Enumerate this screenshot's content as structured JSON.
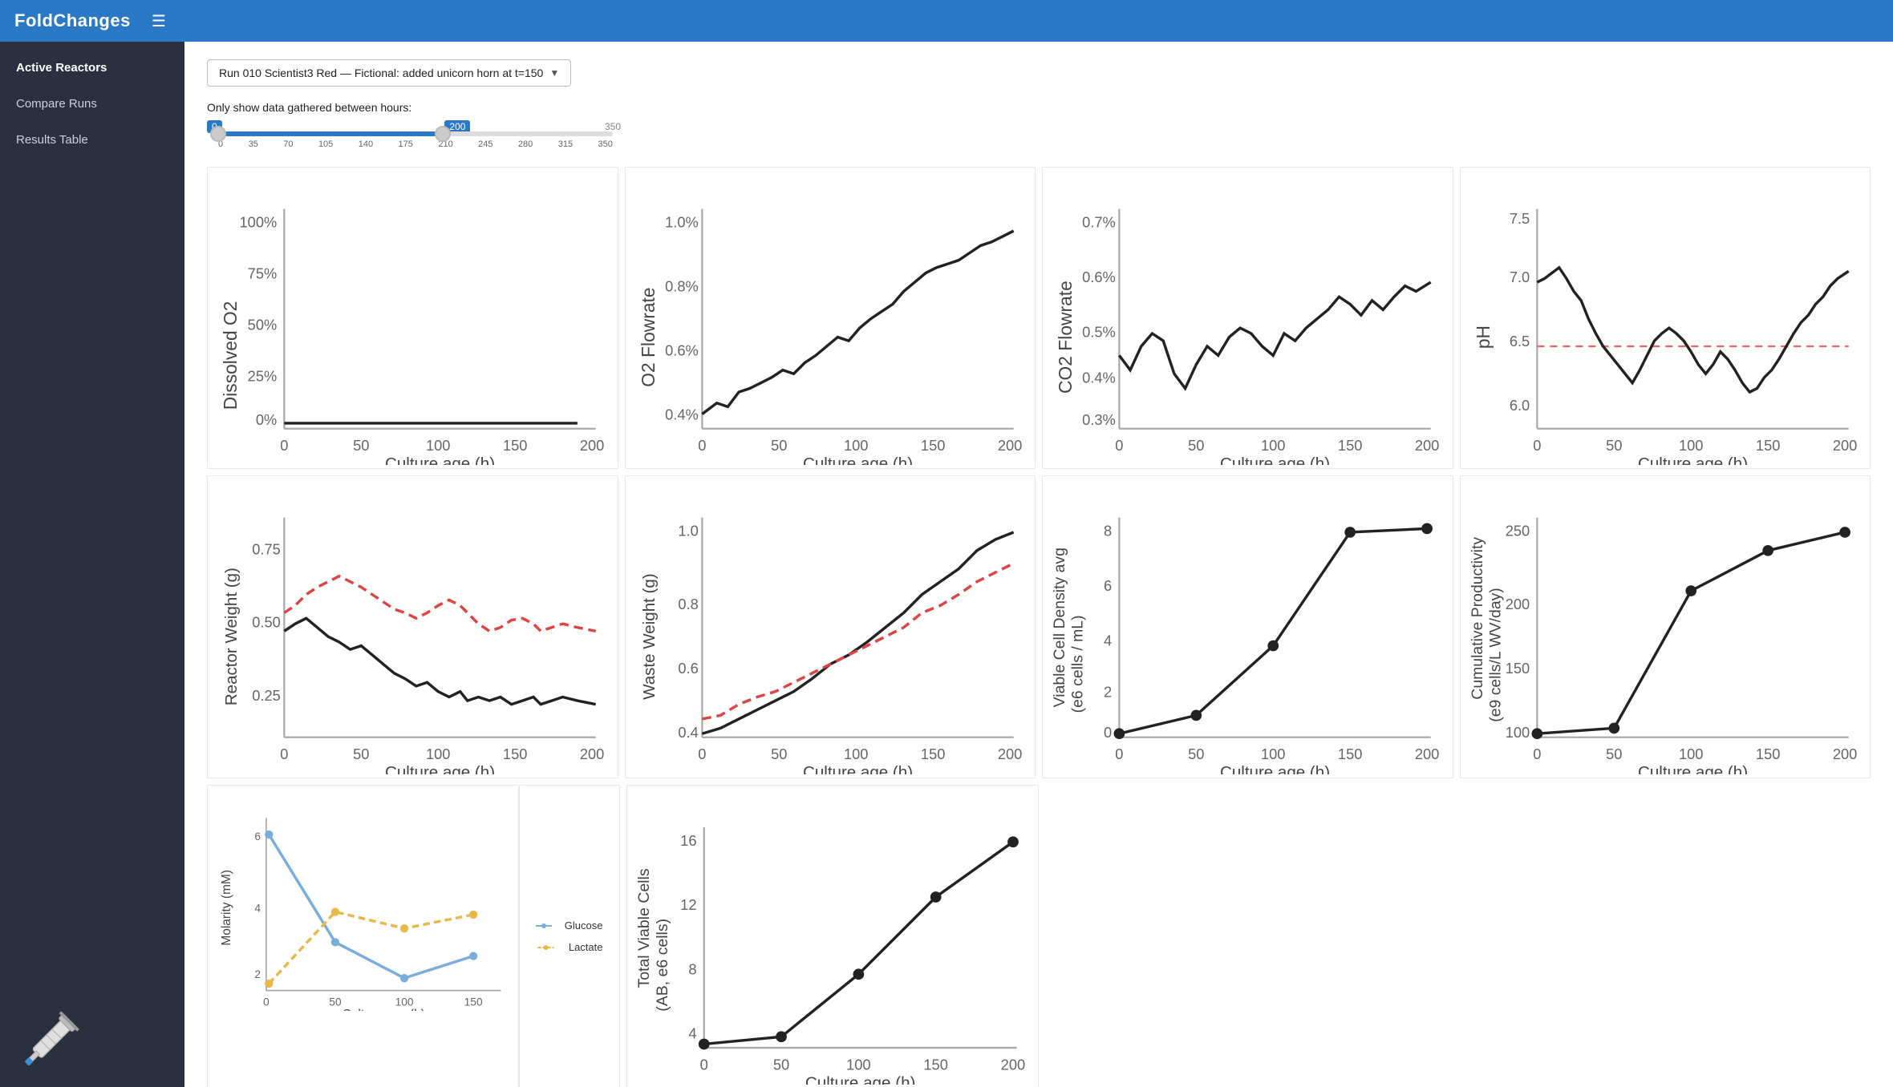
{
  "app": {
    "title": "FoldChanges",
    "hamburger": "☰"
  },
  "sidebar": {
    "items": [
      {
        "label": "Active Reactors",
        "active": true
      },
      {
        "label": "Compare Runs",
        "active": false
      },
      {
        "label": "Results Table",
        "active": false
      }
    ]
  },
  "main": {
    "run_dropdown": {
      "label": "Run 010 Scientist3 Red — Fictional: added unicorn horn at t=150",
      "chevron": "▼"
    },
    "slider": {
      "instruction": "Only show data gathered between hours:",
      "min": 0,
      "max": 350,
      "left_val": "0",
      "right_val": "200",
      "end_val": "350",
      "ticks": [
        "0",
        "35",
        "70",
        "105",
        "140",
        "175",
        "210",
        "245",
        "280",
        "315",
        "350"
      ],
      "fill_percent": 57
    },
    "charts": {
      "row1": [
        {
          "id": "dissolved-o2",
          "ylabel": "Dissolved O2",
          "xlabel": "Culture age (h)",
          "yticks": [
            "0%",
            "25%",
            "50%",
            "75%",
            "100%"
          ]
        },
        {
          "id": "co2-flowrate",
          "ylabel": "O2 Flowrate",
          "xlabel": "Culture age (h)",
          "yticks": [
            "0.4%",
            "0.6%",
            "0.8%",
            "1.0%"
          ]
        },
        {
          "id": "co2-flowrate2",
          "ylabel": "CO2 Flowrate",
          "xlabel": "Culture age (h)",
          "yticks": [
            "0.3%",
            "0.4%",
            "0.5%",
            "0.6%",
            "0.7%"
          ]
        },
        {
          "id": "ph",
          "ylabel": "pH",
          "xlabel": "Culture age (h)",
          "yticks": [
            "6.0",
            "6.5",
            "7.0",
            "7.5"
          ]
        }
      ],
      "row2": [
        {
          "id": "reactor-weight",
          "ylabel": "Reactor Weight (g)",
          "xlabel": "Culture age (h)",
          "yticks": [
            "0.25",
            "0.50",
            "0.75"
          ]
        },
        {
          "id": "waste-weight",
          "ylabel": "Waste Weight (g)",
          "xlabel": "Culture age (h)",
          "yticks": [
            "0.4",
            "0.6",
            "0.8",
            "1.0"
          ]
        },
        {
          "id": "viable-cell-density",
          "ylabel": "Viable Cell Density avg\n(e6 cells / mL)",
          "xlabel": "Culture age (h)",
          "yticks": [
            "0",
            "2",
            "4",
            "6",
            "8"
          ]
        },
        {
          "id": "cumulative-productivity",
          "ylabel": "Cumulative Productivity\n(e9 cells/L WV/day)",
          "xlabel": "Culture age (h)",
          "yticks": [
            "100",
            "150",
            "200",
            "250"
          ]
        }
      ],
      "row3": {
        "molarity": {
          "id": "molarity",
          "ylabel": "Molarity (mM)",
          "xlabel": "Culture age (h)",
          "yticks": [
            "2",
            "4",
            "6"
          ]
        },
        "legend": {
          "items": [
            {
              "label": "Glucose",
              "color": "#7aaddb",
              "type": "line"
            },
            {
              "label": "Lactate",
              "color": "#e8b84b",
              "type": "dashed"
            }
          ]
        },
        "total-viable-cells": {
          "id": "total-viable-cells",
          "ylabel": "Total Viable Cells\n(AB, e6 cells)",
          "xlabel": "Culture age (h)",
          "yticks": [
            "4",
            "8",
            "12",
            "16"
          ]
        }
      }
    }
  }
}
